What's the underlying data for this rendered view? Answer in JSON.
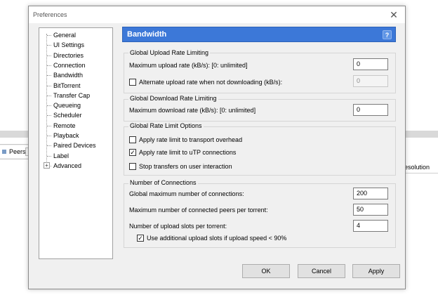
{
  "background": {
    "peers_tab": "Peers",
    "resolution_header": "esolution"
  },
  "dialog": {
    "title": "Preferences",
    "close_glyph": "✕"
  },
  "tree": {
    "items": [
      {
        "label": "General"
      },
      {
        "label": "UI Settings"
      },
      {
        "label": "Directories"
      },
      {
        "label": "Connection"
      },
      {
        "label": "Bandwidth",
        "selected": true
      },
      {
        "label": "BitTorrent"
      },
      {
        "label": "Transfer Cap"
      },
      {
        "label": "Queueing"
      },
      {
        "label": "Scheduler"
      },
      {
        "label": "Remote"
      },
      {
        "label": "Playback"
      },
      {
        "label": "Paired Devices"
      },
      {
        "label": "Label"
      },
      {
        "label": "Advanced",
        "expandable": true
      }
    ],
    "expander_glyph": "+"
  },
  "panel": {
    "title": "Bandwidth",
    "help_glyph": "?"
  },
  "upload": {
    "group_label": "Global Upload Rate Limiting",
    "max_label": "Maximum upload rate (kB/s): [0: unlimited]",
    "max_value": "0",
    "alt_label": "Alternate upload rate when not downloading (kB/s):",
    "alt_checked": false,
    "alt_value": "0"
  },
  "download": {
    "group_label": "Global Download Rate Limiting",
    "max_label": "Maximum download rate (kB/s): [0: unlimited]",
    "max_value": "0"
  },
  "limit_options": {
    "group_label": "Global Rate Limit Options",
    "transport_label": "Apply rate limit to transport overhead",
    "transport_checked": false,
    "utp_label": "Apply rate limit to uTP connections",
    "utp_checked": true,
    "stop_label": "Stop transfers on user interaction",
    "stop_checked": false
  },
  "connections": {
    "group_label": "Number of Connections",
    "global_max_label": "Global maximum number of connections:",
    "global_max_value": "200",
    "peers_label": "Maximum number of connected peers per torrent:",
    "peers_value": "50",
    "slots_label": "Number of upload slots per torrent:",
    "slots_value": "4",
    "additional_label": "Use additional upload slots if upload speed < 90%",
    "additional_checked": true
  },
  "buttons": {
    "ok": "OK",
    "cancel": "Cancel",
    "apply": "Apply"
  },
  "check_glyph": "✓",
  "colors": {
    "header_blue": "#3c78d8",
    "dialog_bg": "#f0f0f0"
  }
}
